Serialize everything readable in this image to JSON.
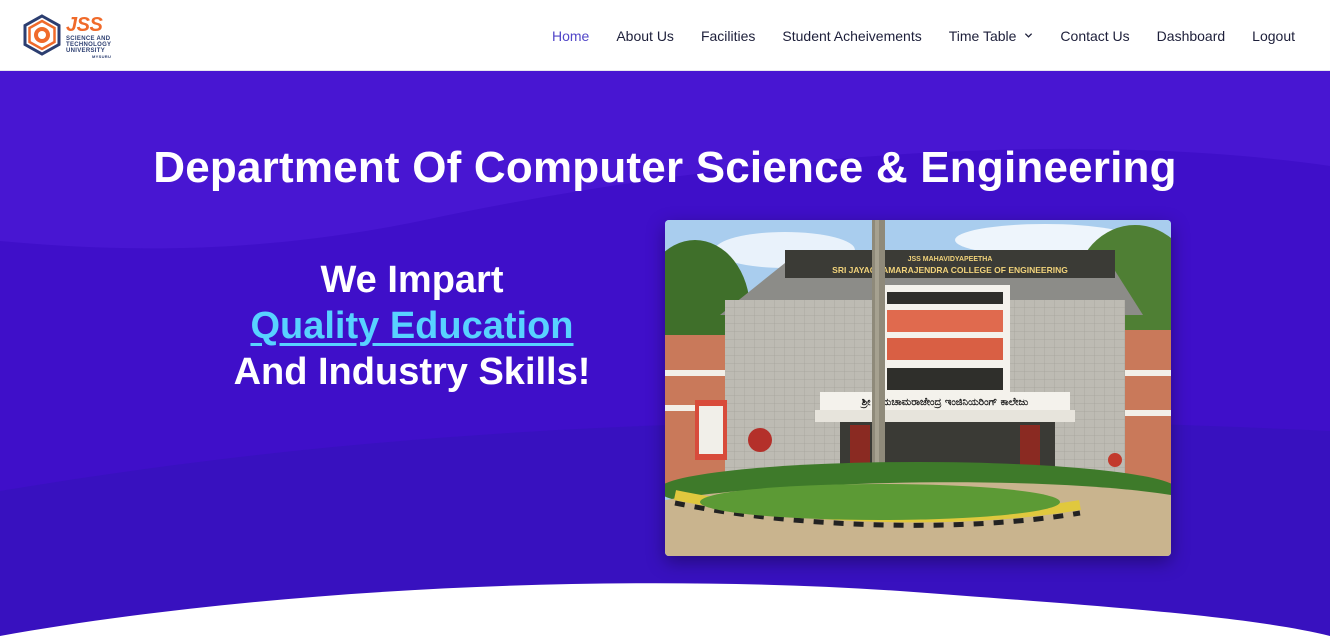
{
  "brand": {
    "name": "JSS",
    "lines": [
      "SCIENCE AND",
      "TECHNOLOGY",
      "UNIVERSITY",
      "MYSURU"
    ]
  },
  "nav": {
    "items": [
      {
        "label": "Home",
        "active": true
      },
      {
        "label": "About Us"
      },
      {
        "label": "Facilities"
      },
      {
        "label": "Student Acheivements"
      },
      {
        "label": "Time Table",
        "dropdown": true
      },
      {
        "label": "Contact Us"
      },
      {
        "label": "Dashboard"
      },
      {
        "label": "Logout"
      }
    ]
  },
  "hero": {
    "title": "Department Of Computer Science & Engineering",
    "tagline_1": "We Impart",
    "tagline_highlight": "Quality Education",
    "tagline_3": "And Industry Skills!",
    "photo": {
      "sign_top": "JSS MAHAVIDYAPEETHA",
      "sign_main": "SRI JAYACHAMARAJENDRA COLLEGE OF ENGINEERING",
      "sign_kannada": "ಶ್ರೀ ಜಯಚಾಮರಾಜೇಂದ್ರ ಇಂಜಿನಿಯರಿಂಗ್ ಕಾಲೇಜು"
    }
  },
  "colors": {
    "hero_bg": "#3d10c8",
    "accent": "#58d2ff",
    "nav_active": "#5146c8",
    "logo_orange": "#f06a2a"
  }
}
